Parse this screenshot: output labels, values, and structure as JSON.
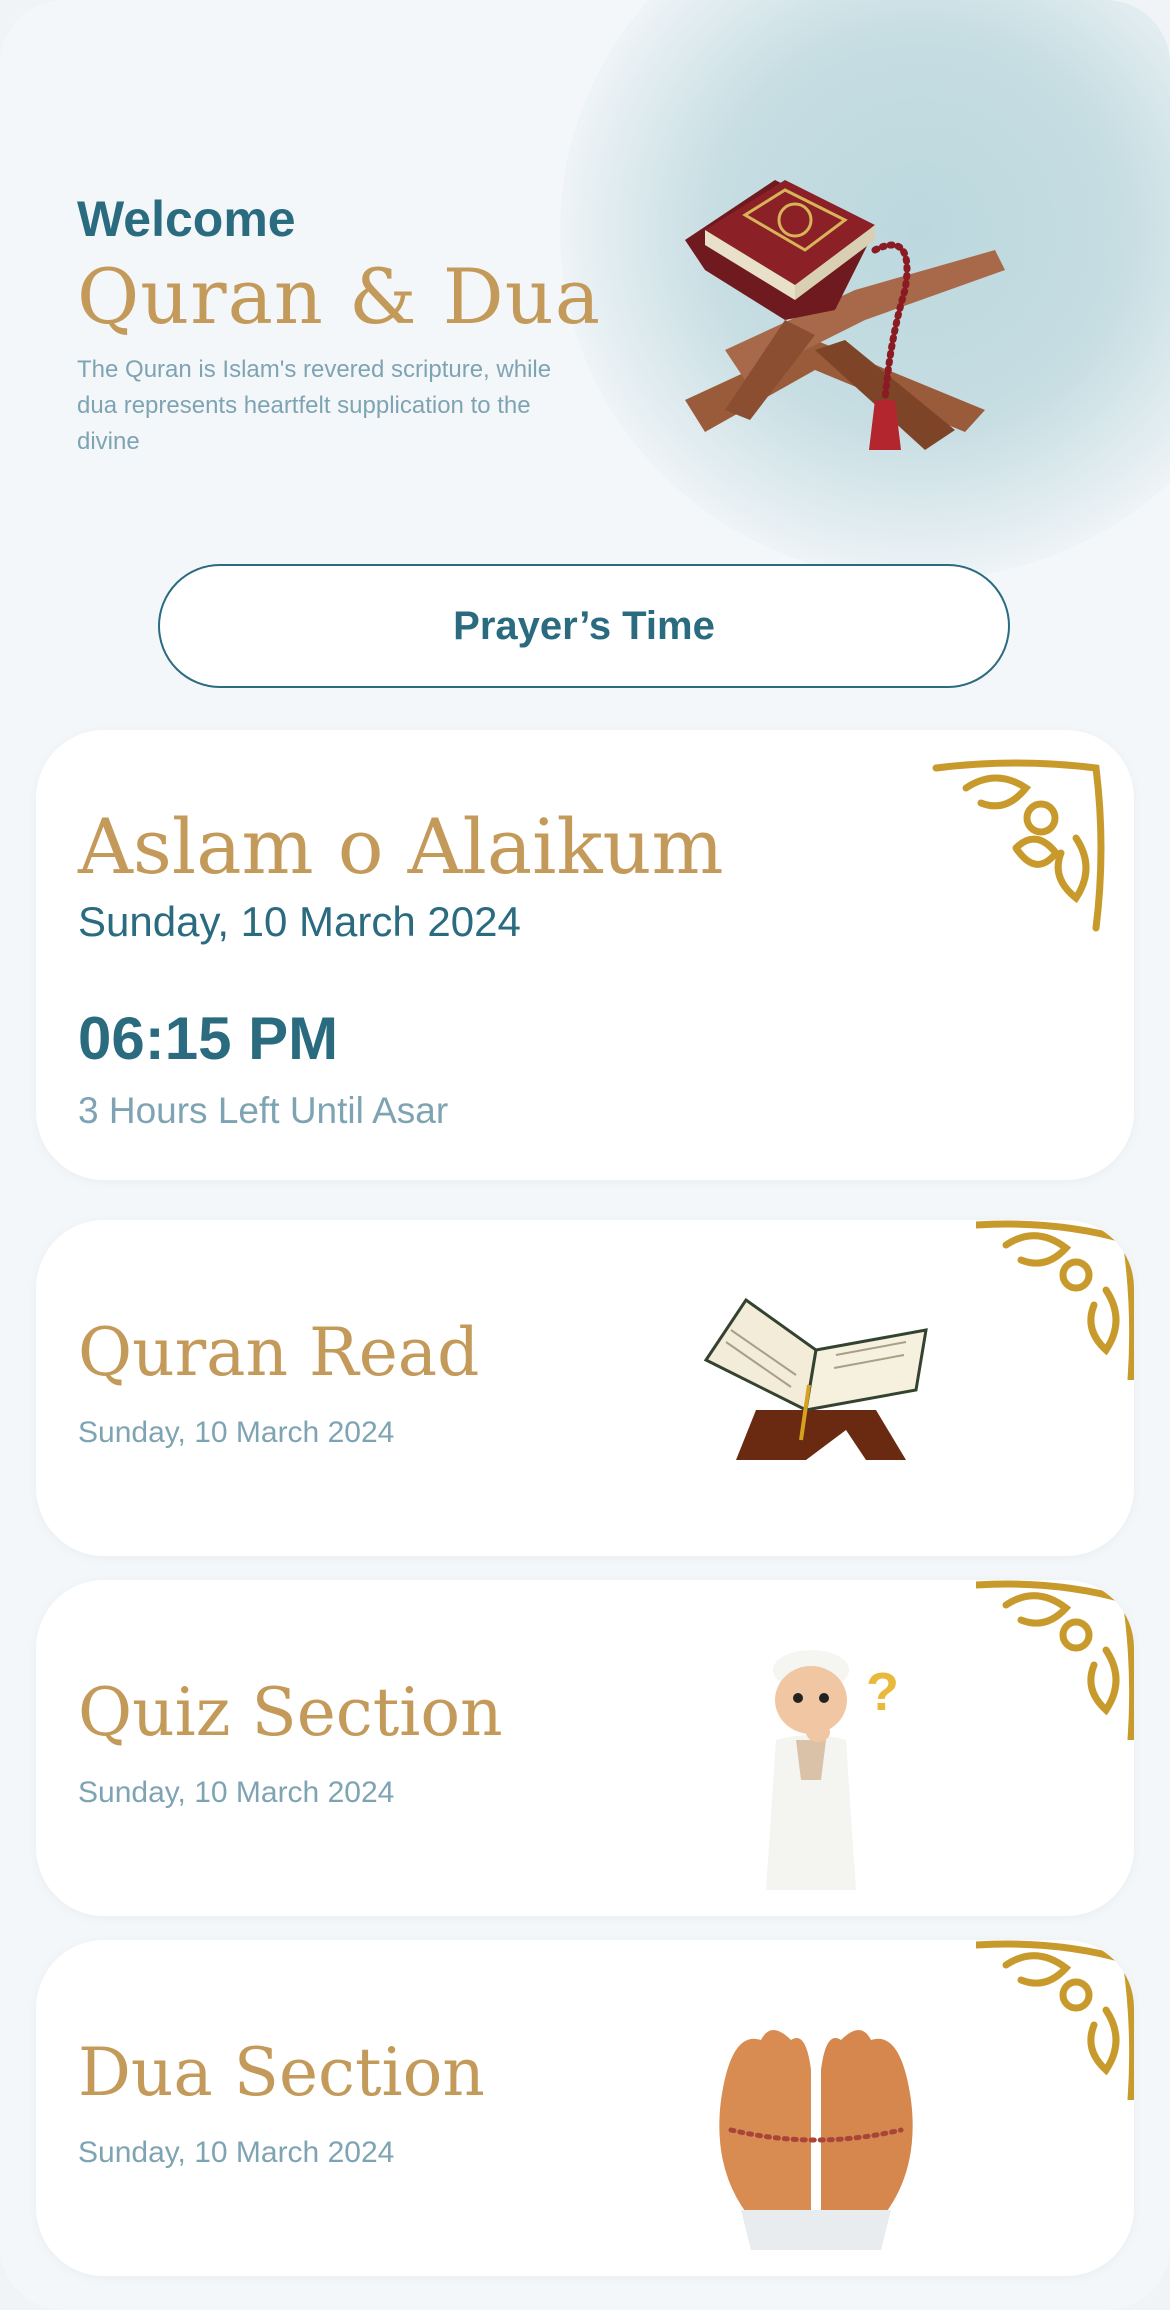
{
  "hero": {
    "welcome": "Welcome",
    "title": "Quran & Dua",
    "description": "The Quran is Islam's revered scripture, while dua represents heartfelt supplication to the divine"
  },
  "prayer_button": {
    "label": "Prayer’s Time"
  },
  "greeting_card": {
    "title": "Aslam o Alaikum",
    "date": "Sunday, 10 March 2024",
    "time": "06:15 PM",
    "remaining": "3 Hours Left Until Asar"
  },
  "cards": [
    {
      "title": "Quran Read",
      "date": "Sunday, 10 March 2024",
      "icon": "open-quran-icon"
    },
    {
      "title": "Quiz Section",
      "date": "Sunday, 10 March 2024",
      "icon": "thinking-boy-icon"
    },
    {
      "title": "Dua Section",
      "date": "Sunday, 10 March 2024",
      "icon": "praying-hands-icon"
    }
  ],
  "colors": {
    "primary": "#2a6b80",
    "gold": "#c39a5a",
    "muted": "#7ea4b4",
    "ornament": "#c89a2c"
  }
}
